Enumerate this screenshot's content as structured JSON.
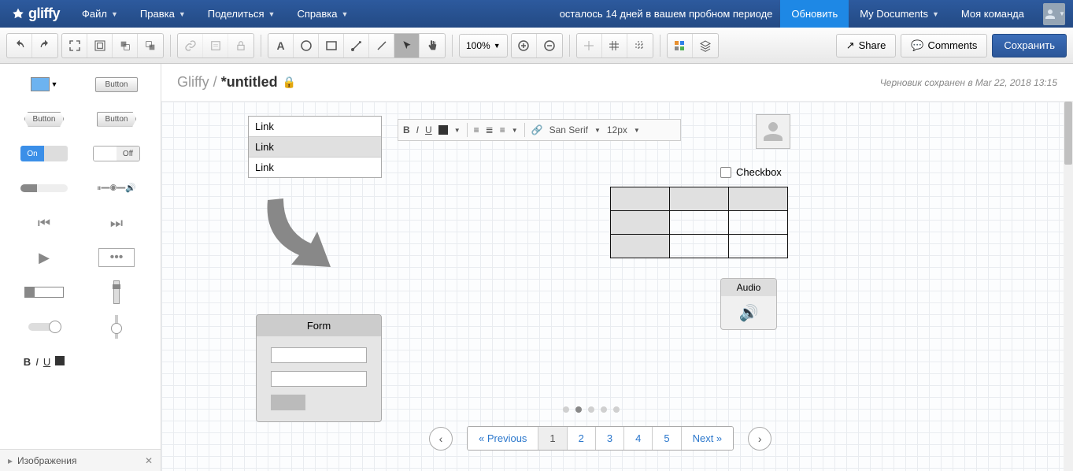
{
  "brand": "gliffy",
  "nav": {
    "file": "Файл",
    "edit": "Правка",
    "share": "Поделиться",
    "help": "Справка",
    "trial": "осталось 14 дней в вашем пробном периоде",
    "update": "Обновить",
    "mydocs": "My Documents",
    "team": "Моя команда"
  },
  "toolbar": {
    "zoom": "100%",
    "share": "Share",
    "comments": "Comments",
    "save": "Сохранить"
  },
  "doc": {
    "crumb": "Gliffy / ",
    "title": "*untitled",
    "status": "Черновик сохранен в Mar 22, 2018 13:15"
  },
  "sidebar": {
    "button_label": "Button",
    "on": "On",
    "off": "Off",
    "footer": "Изображения"
  },
  "canvas": {
    "links": [
      "Link",
      "Link",
      "Link"
    ],
    "rtf_font": "San Serif",
    "rtf_size": "12px",
    "form_title": "Form",
    "checkbox": "Checkbox",
    "audio": "Audio",
    "pager_prev": "« Previous",
    "pager_next": "Next »",
    "pages": [
      "1",
      "2",
      "3",
      "4",
      "5"
    ]
  }
}
